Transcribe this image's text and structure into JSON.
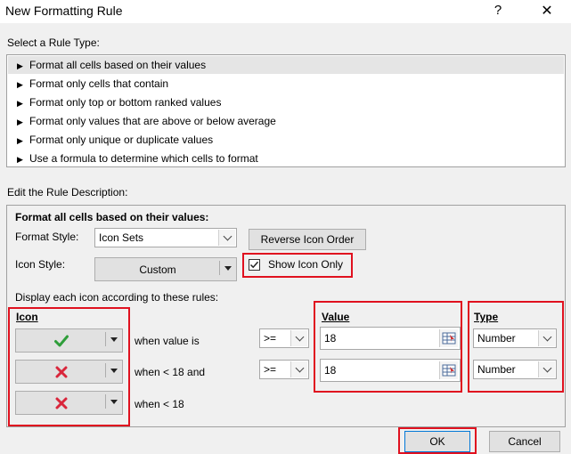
{
  "window": {
    "title": "New Formatting Rule",
    "help": "?",
    "close": "✕"
  },
  "rule_type": {
    "label": "Select a Rule Type:",
    "items": [
      "Format all cells based on their values",
      "Format only cells that contain",
      "Format only top or bottom ranked values",
      "Format only values that are above or below average",
      "Format only unique or duplicate values",
      "Use a formula to determine which cells to format"
    ],
    "selected_index": 0
  },
  "description": {
    "label": "Edit the Rule Description:",
    "heading": "Format all cells based on their values:",
    "format_style_label": "Format Style:",
    "format_style_value": "Icon Sets",
    "reverse_button": "Reverse Icon Order",
    "icon_style_label": "Icon Style:",
    "icon_style_value": "Custom",
    "show_icon_only_label": "Show Icon Only",
    "show_icon_only_checked": true,
    "display_rules_label": "Display each icon according to these rules:",
    "col_icon": "Icon",
    "col_value": "Value",
    "col_type": "Type",
    "rows": [
      {
        "icon": "green-check",
        "condition": "when value is",
        "operator": ">=",
        "value": "18",
        "type": "Number"
      },
      {
        "icon": "red-x",
        "condition": "when < 18 and",
        "operator": ">=",
        "value": "18",
        "type": "Number"
      },
      {
        "icon": "red-x",
        "condition": "when < 18"
      }
    ]
  },
  "buttons": {
    "ok": "OK",
    "cancel": "Cancel"
  },
  "colors": {
    "highlight": "#e0111f",
    "check": "#2f9e3a",
    "cross": "#d9263b"
  }
}
